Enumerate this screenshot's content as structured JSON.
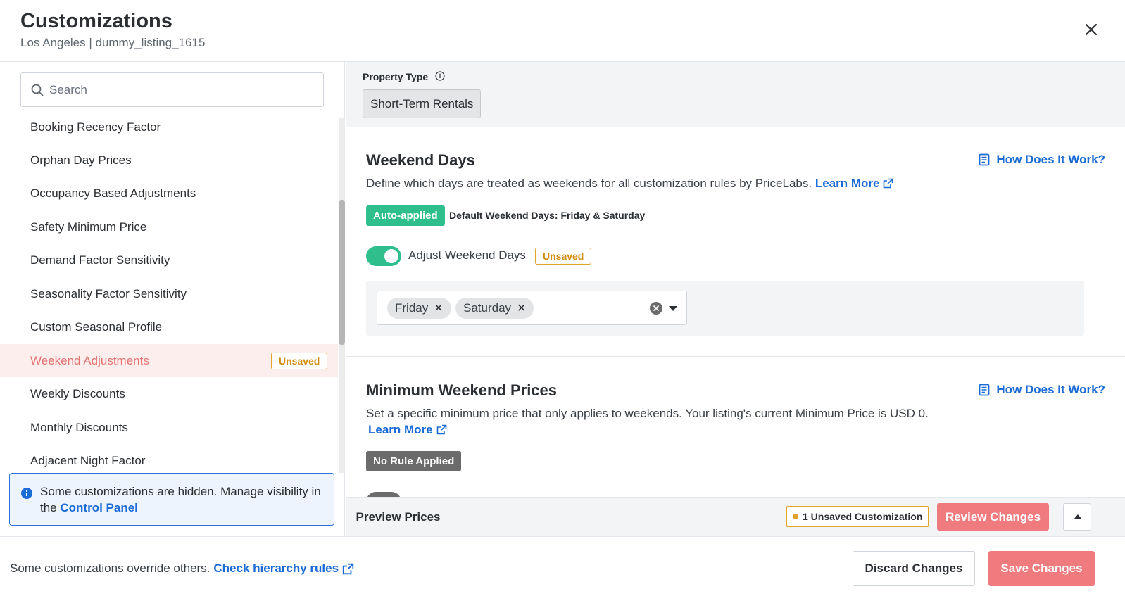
{
  "header": {
    "title": "Customizations",
    "subtitle": "Los Angeles | dummy_listing_1615"
  },
  "sidebar": {
    "search_placeholder": "Search",
    "items": [
      {
        "label": "Booking Recency Factor"
      },
      {
        "label": "Orphan Day Prices"
      },
      {
        "label": "Occupancy Based Adjustments"
      },
      {
        "label": "Safety Minimum Price"
      },
      {
        "label": "Demand Factor Sensitivity"
      },
      {
        "label": "Seasonality Factor Sensitivity"
      },
      {
        "label": "Custom Seasonal Profile"
      },
      {
        "label": "Weekend Adjustments",
        "active": true,
        "badge": "Unsaved"
      },
      {
        "label": "Weekly Discounts"
      },
      {
        "label": "Monthly Discounts"
      },
      {
        "label": "Adjacent Night Factor"
      }
    ],
    "info": {
      "text": "Some customizations are hidden. Manage visibility in the",
      "link": "Control Panel"
    }
  },
  "property": {
    "label": "Property Type",
    "value": "Short-Term Rentals"
  },
  "weekend_days": {
    "title": "Weekend Days",
    "how_link": "How Does It Work?",
    "description": "Define which days are treated as weekends for all customization rules by PriceLabs.",
    "learn_more": "Learn More",
    "auto_badge": "Auto-applied",
    "default_text": "Default Weekend Days: Friday & Saturday",
    "toggle_label": "Adjust Weekend Days",
    "toggle_on": true,
    "unsaved_badge": "Unsaved",
    "selected_days": [
      "Friday",
      "Saturday"
    ]
  },
  "min_weekend_prices": {
    "title": "Minimum Weekend Prices",
    "how_link": "How Does It Work?",
    "description": "Set a specific minimum price that only applies to weekends. Your listing's current Minimum Price is USD 0.",
    "learn_more": "Learn More",
    "status_badge": "No Rule Applied"
  },
  "preview_bar": {
    "preview_label": "Preview Prices",
    "unsaved_count": "1 Unsaved Customization",
    "review_label": "Review Changes"
  },
  "footer": {
    "text": "Some customizations override others.",
    "link": "Check hierarchy rules",
    "discard_label": "Discard Changes",
    "save_label": "Save Changes"
  },
  "colors": {
    "accent_red": "#ef7b7e",
    "success_green": "#2ebf8c",
    "warning_amber": "#e0a526",
    "link_blue": "#1a6bd6"
  }
}
